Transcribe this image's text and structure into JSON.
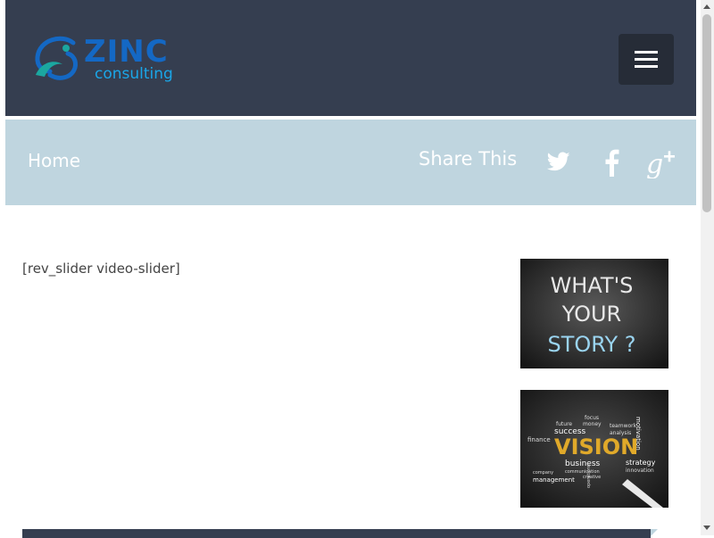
{
  "header": {
    "logo": {
      "name": "ZINC",
      "tagline": "consulting"
    },
    "menu_icon": "hamburger-menu-icon"
  },
  "breadcrumb": {
    "home_label": "Home"
  },
  "share": {
    "label": "Share This",
    "icons": [
      "twitter-icon",
      "facebook-icon",
      "google-plus-icon"
    ]
  },
  "main": {
    "shortcode_text": "[rev_slider video-slider]"
  },
  "sidebar": {
    "thumbs": [
      {
        "icon": "whats-your-story-image",
        "lines": [
          "WHAT'S",
          "YOUR",
          "STORY ?"
        ]
      },
      {
        "icon": "vision-word-cloud-image",
        "headline": "VISION",
        "words": [
          "success",
          "business",
          "finance",
          "strategy",
          "management",
          "motivation",
          "innovation",
          "future",
          "money",
          "focus",
          "teamwork",
          "analysis",
          "communication",
          "creative",
          "company",
          "operations"
        ]
      }
    ]
  },
  "colors": {
    "header_bg": "#353e50",
    "subbar_bg": "#bfd5df",
    "menu_btn_bg": "#262c37",
    "logo_blue": "#1468c4",
    "logo_light_blue": "#1aa6e8",
    "logo_teal": "#1ba7a0"
  }
}
